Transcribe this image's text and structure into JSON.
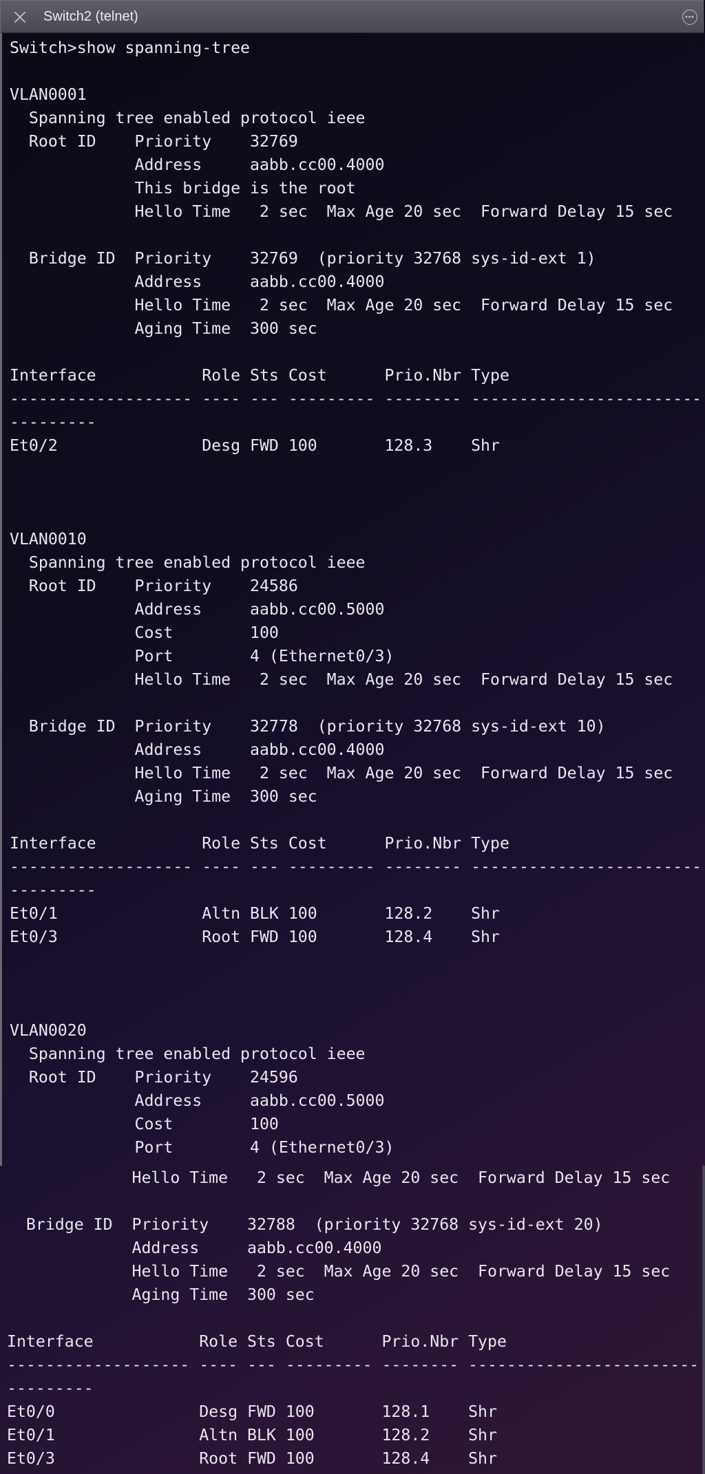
{
  "window": {
    "title": "Switch2 (telnet)",
    "close_icon": "close-icon",
    "more_icon": "more-icon"
  },
  "colors": {
    "text": "#e8e6ee",
    "titlebar": "#55535c"
  },
  "terminal": {
    "top_lines": [
      "Switch>show spanning-tree",
      "",
      "VLAN0001",
      "  Spanning tree enabled protocol ieee",
      "  Root ID    Priority    32769",
      "             Address     aabb.cc00.4000",
      "             This bridge is the root",
      "             Hello Time   2 sec  Max Age 20 sec  Forward Delay 15 sec",
      "",
      "  Bridge ID  Priority    32769  (priority 32768 sys-id-ext 1)",
      "             Address     aabb.cc00.4000",
      "             Hello Time   2 sec  Max Age 20 sec  Forward Delay 15 sec",
      "             Aging Time  300 sec",
      "",
      "Interface           Role Sts Cost      Prio.Nbr Type",
      "------------------- ---- --- --------- -------- ------------------------",
      "---------",
      "Et0/2               Desg FWD 100       128.3    Shr",
      "",
      "",
      "",
      "VLAN0010",
      "  Spanning tree enabled protocol ieee",
      "  Root ID    Priority    24586",
      "             Address     aabb.cc00.5000",
      "             Cost        100",
      "             Port        4 (Ethernet0/3)",
      "             Hello Time   2 sec  Max Age 20 sec  Forward Delay 15 sec",
      "",
      "  Bridge ID  Priority    32778  (priority 32768 sys-id-ext 10)",
      "             Address     aabb.cc00.4000",
      "             Hello Time   2 sec  Max Age 20 sec  Forward Delay 15 sec",
      "             Aging Time  300 sec",
      "",
      "Interface           Role Sts Cost      Prio.Nbr Type",
      "------------------- ---- --- --------- -------- ------------------------",
      "---------",
      "Et0/1               Altn BLK 100       128.2    Shr",
      "Et0/3               Root FWD 100       128.4    Shr",
      "",
      "",
      "",
      "VLAN0020",
      "  Spanning tree enabled protocol ieee",
      "  Root ID    Priority    24596",
      "             Address     aabb.cc00.5000",
      "             Cost        100",
      "             Port        4 (Ethernet0/3)"
    ],
    "bottom_lines": [
      "             Hello Time   2 sec  Max Age 20 sec  Forward Delay 15 sec",
      "",
      "  Bridge ID  Priority    32788  (priority 32768 sys-id-ext 20)",
      "             Address     aabb.cc00.4000",
      "             Hello Time   2 sec  Max Age 20 sec  Forward Delay 15 sec",
      "             Aging Time  300 sec",
      "",
      "Interface           Role Sts Cost      Prio.Nbr Type",
      "------------------- ---- --- --------- -------- ------------------------",
      "---------",
      "Et0/0               Desg FWD 100       128.1    Shr",
      "Et0/1               Altn BLK 100       128.2    Shr",
      "Et0/3               Root FWD 100       128.4    Shr"
    ]
  }
}
